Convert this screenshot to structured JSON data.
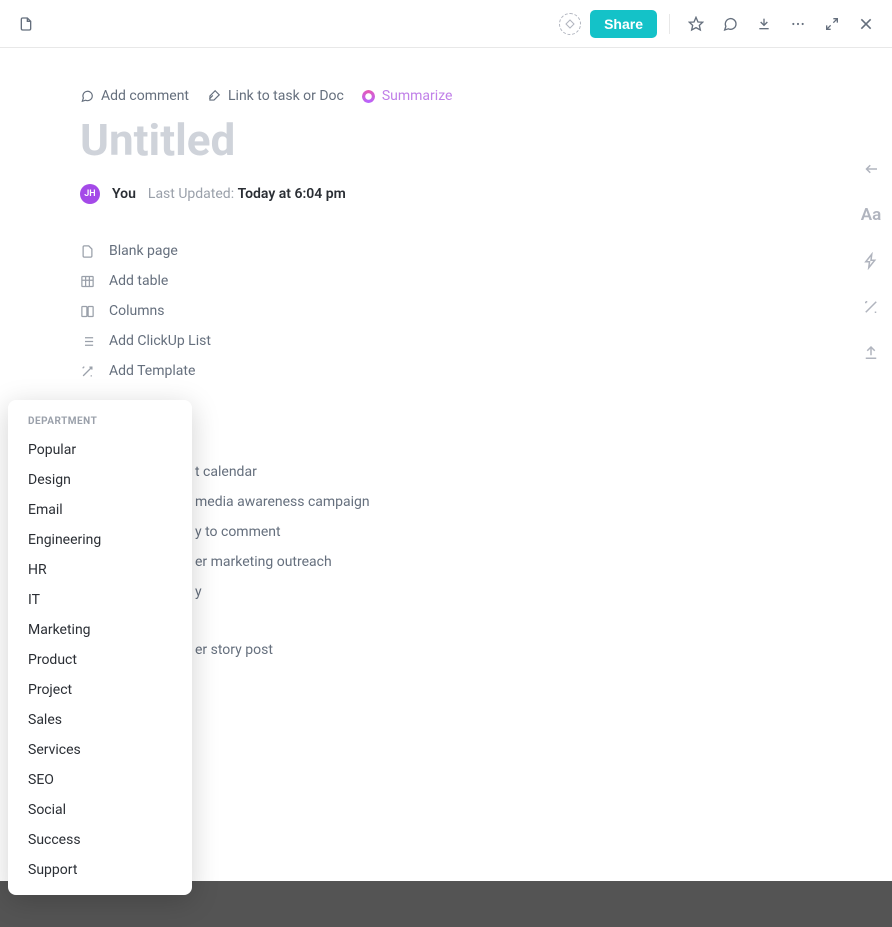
{
  "topbar": {
    "share": "Share"
  },
  "doc_actions": {
    "comment": "Add comment",
    "link_task": "Link to task or Doc",
    "summarize": "Summarize"
  },
  "title": "Untitled",
  "meta": {
    "avatar_initials": "JH",
    "author": "You",
    "updated_label": "Last Updated:",
    "updated_time": "Today at 6:04 pm"
  },
  "blocks": [
    "Blank page",
    "Add table",
    "Columns",
    "Add ClickUp List",
    "Add Template"
  ],
  "suggestions_header": [
    "",
    ""
  ],
  "suggestions": [
    "t calendar",
    "media awareness campaign",
    "y to comment",
    "er marketing outreach",
    "y",
    "",
    "",
    "er story post"
  ],
  "popover": {
    "heading": "DEPARTMENT",
    "items": [
      "Popular",
      "Design",
      "Email",
      "Engineering",
      "HR",
      "IT",
      "Marketing",
      "Product",
      "Project",
      "Sales",
      "Services",
      "SEO",
      "Social",
      "Success",
      "Support"
    ]
  },
  "side_tools": {
    "font": "Aa"
  }
}
